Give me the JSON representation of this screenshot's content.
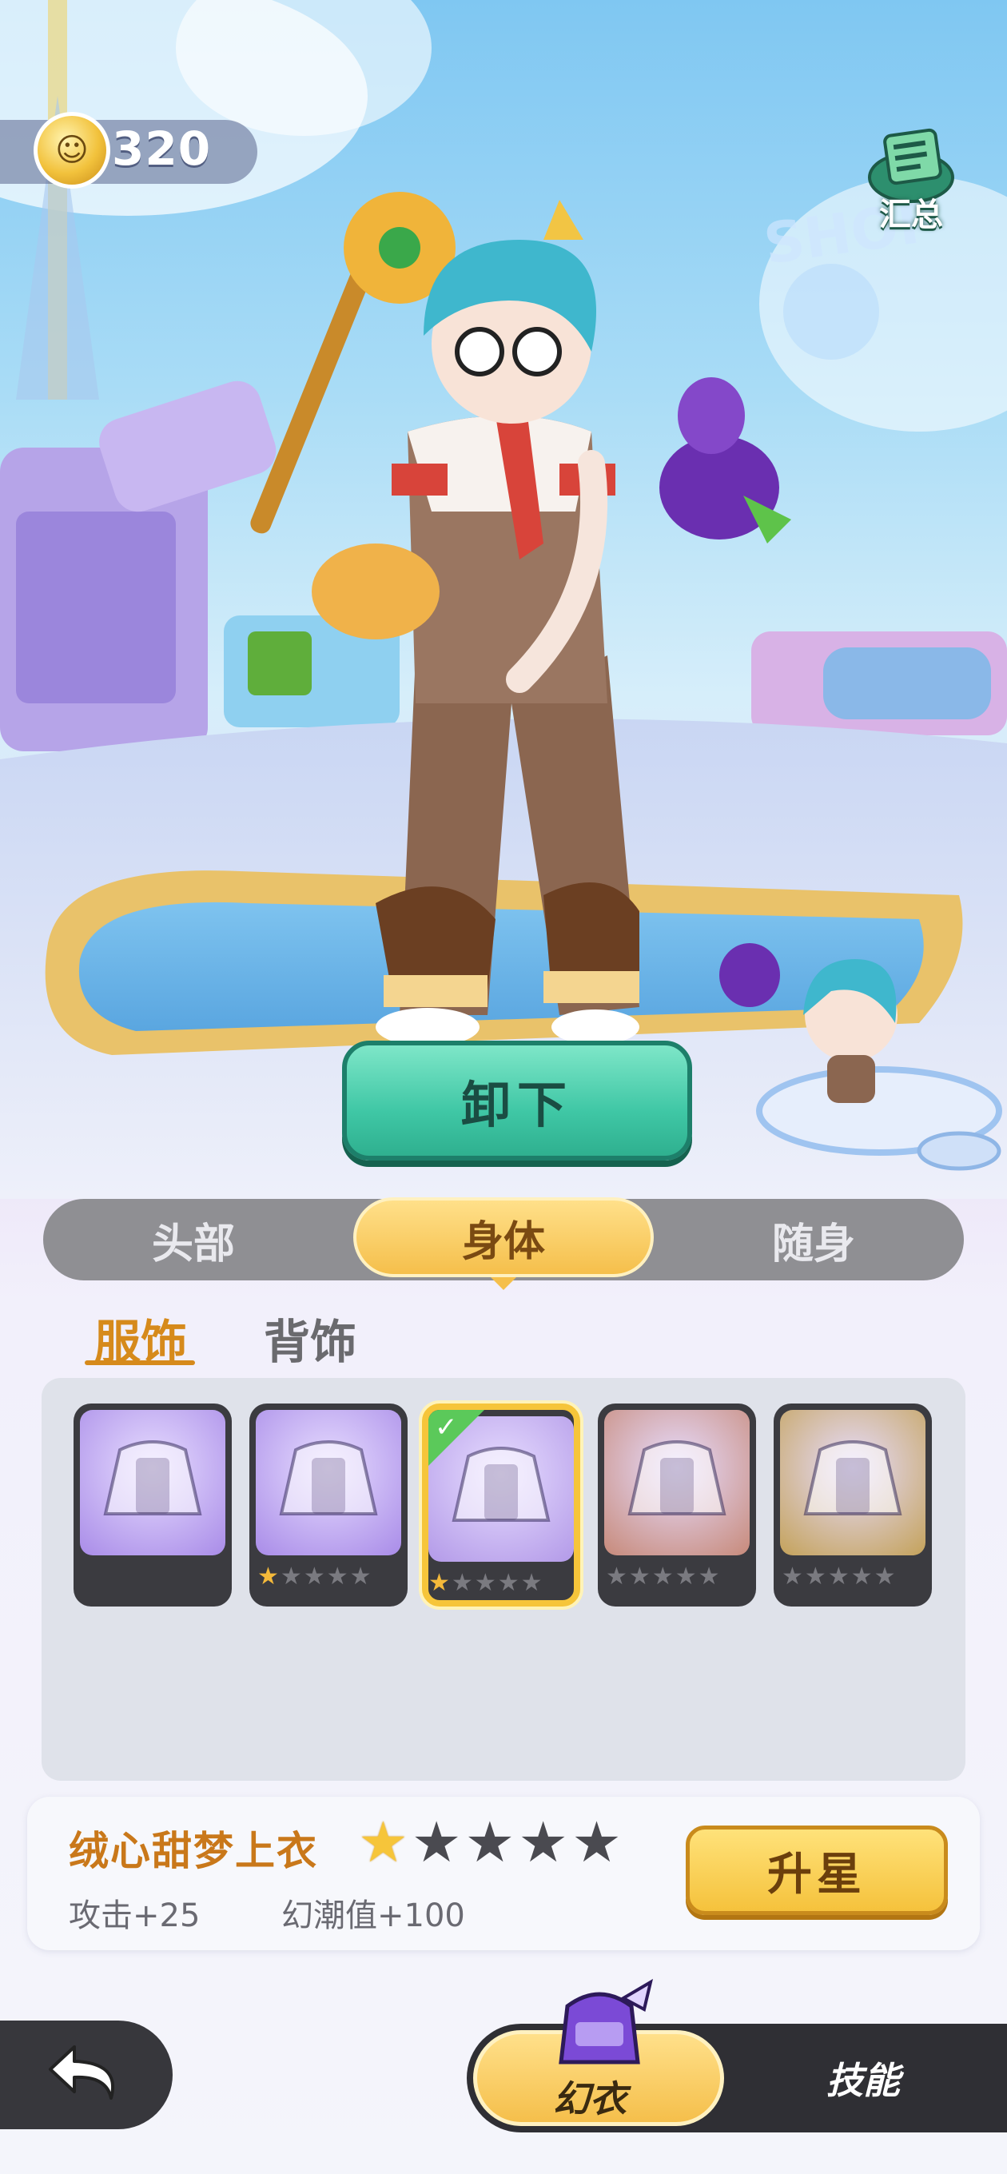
{
  "currency": {
    "icon": "coin-icon",
    "value": "320"
  },
  "summary": {
    "label": "汇总",
    "icon": "summary-book-icon"
  },
  "actions": {
    "unequip_label": "卸下",
    "upgrade_label": "升星"
  },
  "slot_tabs": [
    {
      "label": "头部",
      "selected": false
    },
    {
      "label": "身体",
      "selected": true
    },
    {
      "label": "随身",
      "selected": false
    }
  ],
  "sub_tabs": [
    {
      "label": "服饰",
      "selected": true
    },
    {
      "label": "背饰",
      "selected": false
    }
  ],
  "items": [
    {
      "name": "blue-jacket",
      "stars": null,
      "selected": false
    },
    {
      "name": "purple-jacket",
      "stars": 1,
      "selected": false
    },
    {
      "name": "overalls-top",
      "stars": 1,
      "selected": true,
      "equipped": true
    },
    {
      "name": "white-robe",
      "stars": 0,
      "selected": false
    },
    {
      "name": "armor-suit",
      "stars": 0,
      "selected": false
    }
  ],
  "selected_item": {
    "name": "绒心甜梦上衣",
    "stars": 1,
    "max_stars": 5,
    "stats": [
      "攻击+25",
      "幻潮值+100"
    ]
  },
  "bottom_tabs": [
    {
      "label": "幻衣",
      "selected": true,
      "icon": "costume-icon"
    },
    {
      "label": "技能",
      "selected": false
    }
  ],
  "colors": {
    "accent": "#f5bf4b",
    "primary_green": "#3fc7a5",
    "name_orange": "#c9781a"
  }
}
